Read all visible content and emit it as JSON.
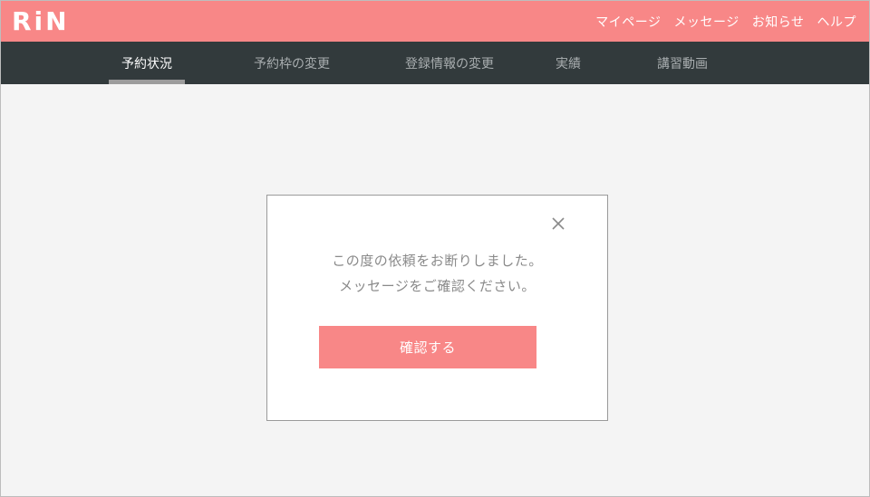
{
  "header": {
    "logo": "RiN",
    "nav": [
      {
        "label": "マイページ"
      },
      {
        "label": "メッセージ"
      },
      {
        "label": "お知らせ"
      },
      {
        "label": "ヘルプ"
      }
    ]
  },
  "tabs": [
    {
      "label": "予約状況",
      "active": true
    },
    {
      "label": "予約枠の変更",
      "active": false
    },
    {
      "label": "登録情報の変更",
      "active": false
    },
    {
      "label": "実績",
      "active": false
    },
    {
      "label": "講習動画",
      "active": false
    }
  ],
  "modal": {
    "message_line1": "この度の依頼をお断りしました。",
    "message_line2": "メッセージをご確認ください。",
    "confirm_label": "確認する",
    "close_icon": "close-icon"
  },
  "colors": {
    "brand": "#f88787",
    "tabbar": "#323a3c",
    "background": "#f4f4f4"
  }
}
